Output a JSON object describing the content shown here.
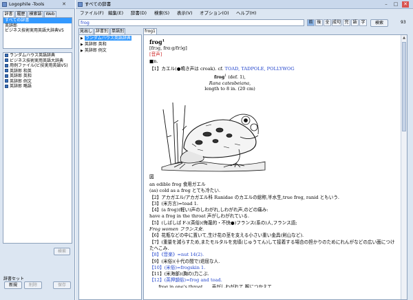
{
  "tools": {
    "title": "Logophile -Tools",
    "tabs": [
      "辞書",
      "履歴",
      "検索語",
      "Web"
    ],
    "dict_sets": [
      "すべての辞書",
      "英辞郎",
      "ビジネス技術実用英語大辞典V5"
    ],
    "dictionaries": [
      "ランダムハウス英語辞典",
      "ビジネス技術実用英語大辞典",
      "用例ファイル(ビ技実用英語V5)",
      "英辞郎 和英",
      "英辞郎 英和",
      "英辞郎 例文",
      "英辞郎 略語"
    ],
    "search_button": "検索",
    "dict_set_label": "辞書セット",
    "buttons": {
      "new": "新規",
      "delete": "削除",
      "save": "保存"
    }
  },
  "main": {
    "title": "すべての辞書",
    "menu": [
      "ファイル(F)",
      "編集(E)",
      "辞書(D)",
      "検索(S)",
      "表示(V)",
      "オプション(O)",
      "ヘルプ(H)"
    ],
    "search_value": "frog",
    "search_modes": [
      "前",
      "後",
      "全",
      "成句",
      "完",
      "語",
      "字"
    ],
    "search_button": "検索",
    "result_count": "93",
    "left_tabs": [
      "見出し",
      "辞書別",
      "単語別"
    ],
    "tree": [
      "ランダムハウス英語辞典",
      "英辞郎 英和",
      "英辞郎 例文"
    ],
    "entry_tab": "frog1",
    "entry": {
      "headword": "frog",
      "sup": "1",
      "pron": "[frɔg, frɑːg/frɔ́g]",
      "audio": "[音声]",
      "pos": "■n.",
      "line1_pre": "【1】カエル(●鳴き声は croak). cf. ",
      "line1_links": "TOAD, TADPOLE, POLLYWOG",
      "caption_head": "frog",
      "caption_sup": "1",
      "caption_def": " (def. 1),",
      "caption_sci": "Rana catesbeiana,",
      "caption_len": "length to 8 in. (20 cm)",
      "fig_marker": "図",
      "lines": [
        "an edible frog 食用ガエル",
        "(as) cold as a frog とても冷たい.",
        "【2】アカガエル/アカガエル科 Ranidae のカエルの総称,半水生,true frog, ranid ともいう.",
        "【3】(米方言)=toad 1.",
        "【4】(a frog)(軽い)声のしわがれ,しわがれ声,のどの痛み:",
        "have a frog in the throat 声がしわがれている.",
        "【5】(しばしば F-)(英俗)(侮蔑的・不快●)フランス(系の)人,フランス語;",
        "Frog women フランス女.",
        "【6】花瓶などの中に置いて,生け花の茎を支える小さい重い金具(剣山など).",
        "【7】(重量を減らすため,またモルタルを充填(じゅうてん)して接着する場合の担かりのためにれんがなどの広い面につけたへこみ.",
        "【8】《音楽》=nut 14(2).",
        "【9】(米俗)(十代の間で)退屈な人.",
        "【10】(米俗)=frogskin 1.",
        "【11】(米海部)(胸の)力こぶ.",
        "【12】(英押韻俗)=frog and toad."
      ],
      "last_partial": "……frog in one's throat……声がしわがれて,喉につかえて"
    }
  },
  "colors": {
    "accent": "#3399ff",
    "link": "#2244cc",
    "audio": "#cc2222",
    "chrome": "#dce6f2"
  }
}
